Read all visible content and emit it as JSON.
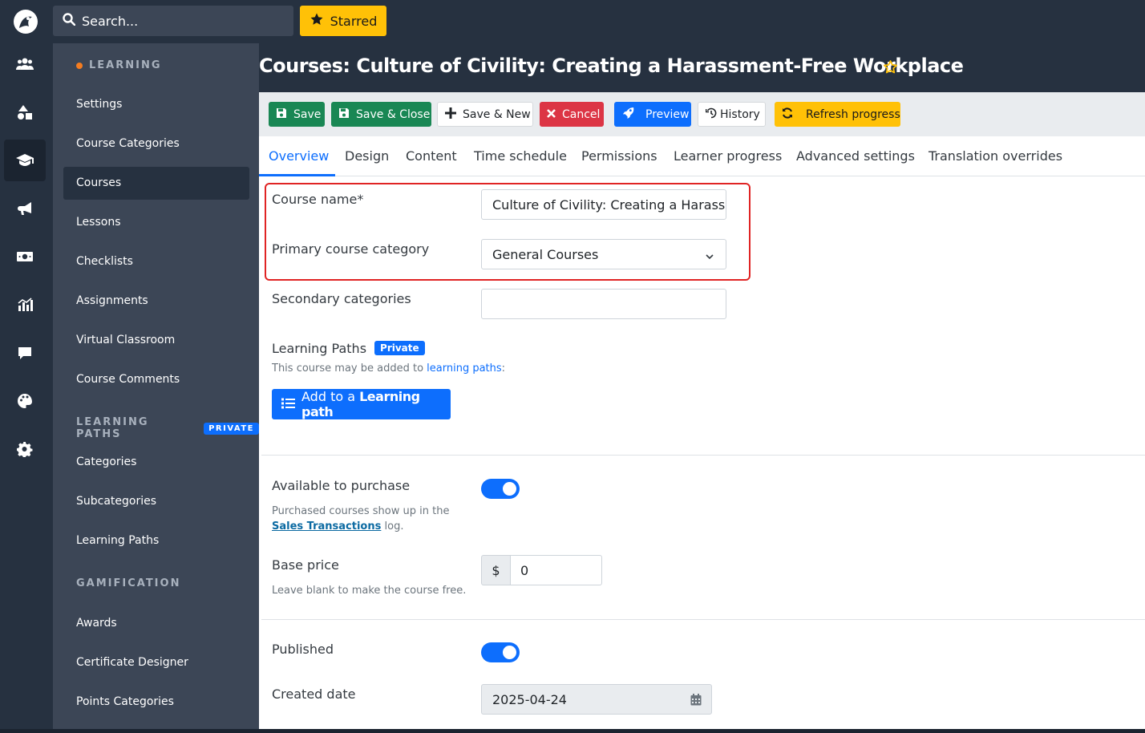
{
  "topbar": {
    "search_placeholder": "Search...",
    "starred_label": "Starred"
  },
  "rail": {
    "icons": [
      "users-icon",
      "shapes-icon",
      "graduation-cap-icon",
      "megaphone-icon",
      "money-icon",
      "chart-icon",
      "comment-icon",
      "palette-icon",
      "gear-icon"
    ],
    "active": "graduation-cap-icon"
  },
  "sidebar": {
    "learning_heading": "LEARNING",
    "learning_items": [
      "Settings",
      "Course Categories",
      "Courses",
      "Lessons",
      "Checklists",
      "Assignments",
      "Virtual Classroom",
      "Course Comments"
    ],
    "active_item": "Courses",
    "paths_heading": "LEARNING PATHS",
    "paths_badge": "PRIVATE",
    "paths_items": [
      "Categories",
      "Subcategories",
      "Learning Paths"
    ],
    "gamification_heading": "GAMIFICATION",
    "gamification_items": [
      "Awards",
      "Certificate Designer",
      "Points Categories"
    ]
  },
  "header": {
    "title": "Courses: Culture of Civility: Creating a Harassment-Free Workplace"
  },
  "toolbar": {
    "save": "Save",
    "save_close": "Save & Close",
    "save_new": "Save & New",
    "cancel": "Cancel",
    "preview": "Preview",
    "history": "History",
    "refresh": "Refresh progress"
  },
  "tabs": [
    "Overview",
    "Design",
    "Content",
    "Time schedule",
    "Permissions",
    "Learner progress",
    "Advanced settings",
    "Translation overrides"
  ],
  "form": {
    "course_name_label": "Course name*",
    "course_name_value": "Culture of Civility: Creating a Harassment-Free Workplace",
    "primary_category_label": "Primary course category",
    "primary_category_value": "General Courses",
    "secondary_label": "Secondary categories",
    "secondary_value": "",
    "learning_paths_label": "Learning Paths",
    "learning_paths_badge": "Private",
    "learning_paths_help_prefix": "This course may be added to ",
    "learning_paths_help_link": "learning paths",
    "learning_paths_help_suffix": ":",
    "add_lp_prefix": "Add to a ",
    "add_lp_bold": "Learning path",
    "purchase_label": "Available to purchase",
    "purchase_on": true,
    "purchase_help_1": "Purchased courses show up in the",
    "purchase_help_link": "Sales Transactions",
    "purchase_help_2": " log.",
    "price_label": "Base price",
    "price_currency": "$",
    "price_value": "0",
    "price_help": "Leave blank to make the course free.",
    "published_label": "Published",
    "published_on": true,
    "created_label": "Created date",
    "created_value": "2025-04-24"
  },
  "colors": {
    "primary": "#0d6efd",
    "success": "#198754",
    "danger": "#dc3545",
    "warning": "#ffc107",
    "highlight": "#e02424"
  }
}
